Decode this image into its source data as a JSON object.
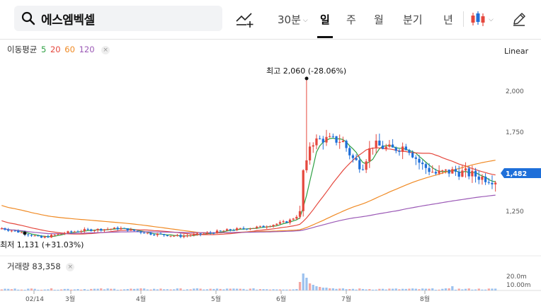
{
  "search": {
    "value": "에스엠벡셀"
  },
  "tabs": [
    {
      "label": "30분",
      "has_caret": true
    },
    {
      "label": "일",
      "active": true
    },
    {
      "label": "주"
    },
    {
      "label": "월"
    },
    {
      "label": "분기"
    },
    {
      "label": "년"
    }
  ],
  "icons": {
    "search": "search-icon",
    "indicator": "indicator-add-icon",
    "chart_type": "candlestick-icon",
    "draw": "pencil-icon"
  },
  "ma_legend": {
    "label": "이동평균",
    "periods": [
      {
        "value": "5",
        "color": "#2ea043"
      },
      {
        "value": "20",
        "color": "#e5483e"
      },
      {
        "value": "60",
        "color": "#f08a24"
      },
      {
        "value": "120",
        "color": "#9b59b6"
      }
    ]
  },
  "scale": {
    "label": "Linear"
  },
  "volume_legend": {
    "label": "거래량",
    "value": "83,358"
  },
  "annotations": {
    "high": "최고 2,060 (-28.06%)",
    "low": "최저 1,131 (+31.03%)"
  },
  "last_price": "1,482",
  "chart_data": {
    "type": "candlestick",
    "price_axis": {
      "ticks": [
        1250,
        1500,
        1750,
        2000
      ],
      "tick_labels": [
        "1,250",
        "1,500",
        "1,750",
        "2,000"
      ],
      "ylim": [
        1075,
        2155
      ]
    },
    "volume_axis": {
      "tick_labels": [
        "20.0m",
        "10.00m"
      ]
    },
    "x_ticks": [
      "02/14",
      "3월",
      "4월",
      "5월",
      "6월",
      "7월",
      "8월"
    ],
    "ohlc_points": [
      {
        "o": 1180,
        "h": 1195,
        "l": 1165,
        "c": 1175
      },
      {
        "o": 1170,
        "h": 1185,
        "l": 1131,
        "c": 1150
      },
      {
        "o": 1160,
        "h": 1210,
        "l": 1150,
        "c": 1200
      },
      {
        "o": 1190,
        "h": 1240,
        "l": 1180,
        "c": 1185
      },
      {
        "o": 1185,
        "h": 1205,
        "l": 1160,
        "c": 1170
      },
      {
        "o": 1170,
        "h": 1195,
        "l": 1150,
        "c": 1160
      },
      {
        "o": 1165,
        "h": 1215,
        "l": 1160,
        "c": 1210
      },
      {
        "o": 1215,
        "h": 1300,
        "l": 1200,
        "c": 1290
      },
      {
        "o": 1290,
        "h": 2060,
        "l": 1280,
        "c": 1530
      },
      {
        "o": 1530,
        "h": 1910,
        "l": 1500,
        "c": 1820
      },
      {
        "o": 1800,
        "h": 1860,
        "l": 1600,
        "c": 1650
      },
      {
        "o": 1680,
        "h": 1720,
        "l": 1560,
        "c": 1580
      },
      {
        "o": 1590,
        "h": 1720,
        "l": 1570,
        "c": 1700
      },
      {
        "o": 1700,
        "h": 1760,
        "l": 1620,
        "c": 1640
      },
      {
        "o": 1640,
        "h": 1700,
        "l": 1540,
        "c": 1560
      },
      {
        "o": 1560,
        "h": 1600,
        "l": 1490,
        "c": 1510
      },
      {
        "o": 1510,
        "h": 1770,
        "l": 1490,
        "c": 1530
      },
      {
        "o": 1530,
        "h": 1560,
        "l": 1470,
        "c": 1482
      }
    ]
  }
}
